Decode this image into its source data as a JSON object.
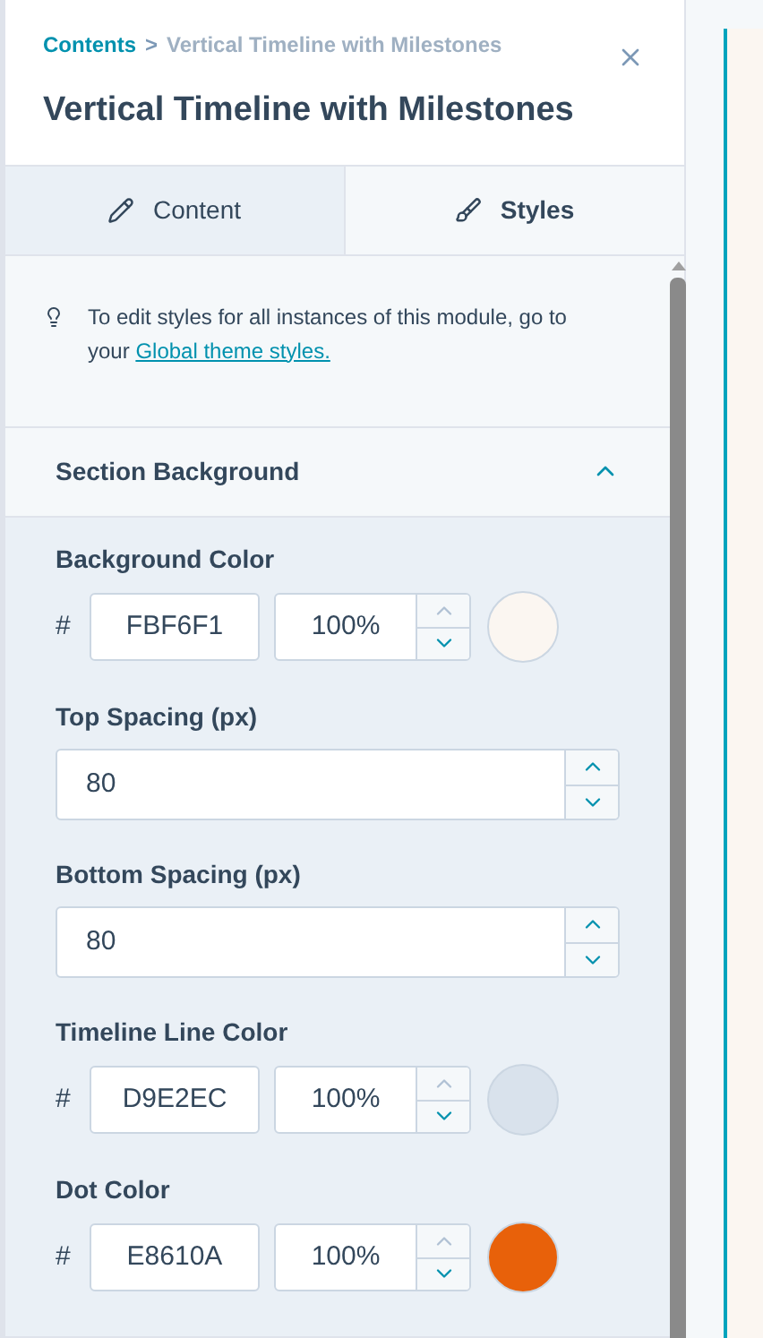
{
  "breadcrumb": {
    "parent": "Contents",
    "separator": ">",
    "current": "Vertical Timeline with Milestones"
  },
  "title": "Vertical Timeline with Milestones",
  "tabs": [
    {
      "label": "Content",
      "selected": false
    },
    {
      "label": "Styles",
      "selected": true
    }
  ],
  "notice": {
    "text": "To edit styles for all instances of this module, go to your",
    "link": "Global theme styles."
  },
  "section": {
    "title": "Section Background",
    "expanded": true,
    "fields": [
      {
        "kind": "color",
        "label": "Background Color",
        "prefix": "#",
        "value": "FBF6F1",
        "opacity": "100%",
        "color": "#fbf6f1"
      },
      {
        "kind": "number",
        "label": "Top Spacing (px)",
        "value": "80"
      },
      {
        "kind": "number",
        "label": "Bottom Spacing (px)",
        "value": "80"
      },
      {
        "kind": "color",
        "label": "Timeline Line Color",
        "prefix": "#",
        "value": "D9E2EC",
        "opacity": "100%",
        "color": "#d9e2ec"
      },
      {
        "kind": "color",
        "label": "Dot Color",
        "prefix": "#",
        "value": "E8610A",
        "opacity": "100%",
        "color": "#e8610a"
      }
    ]
  }
}
